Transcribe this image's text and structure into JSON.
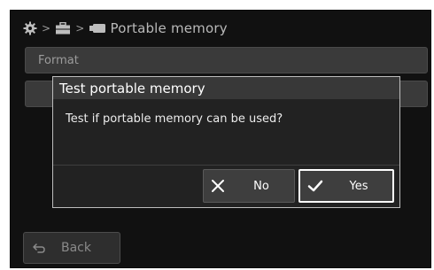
{
  "breadcrumb": {
    "icons": [
      "gear-icon",
      "chevron-right-icon",
      "toolbox-icon",
      "chevron-right-icon",
      "usb-drive-icon"
    ],
    "label": "Portable memory"
  },
  "menu": {
    "items": [
      {
        "label": "Format"
      },
      {
        "label": ""
      }
    ]
  },
  "dialog": {
    "title": "Test portable memory",
    "message": "Test if portable memory can be used?",
    "no_label": "No",
    "yes_label": "Yes",
    "no_icon": "x-icon",
    "yes_icon": "checkmark-icon"
  },
  "footer": {
    "back_label": "Back",
    "back_icon": "return-arrow-icon"
  },
  "colors": {
    "background": "#111111",
    "dialog_bg": "#222222",
    "title_bar": "#383838",
    "button": "#3e3e3e",
    "highlight_border": "#ffffff"
  }
}
